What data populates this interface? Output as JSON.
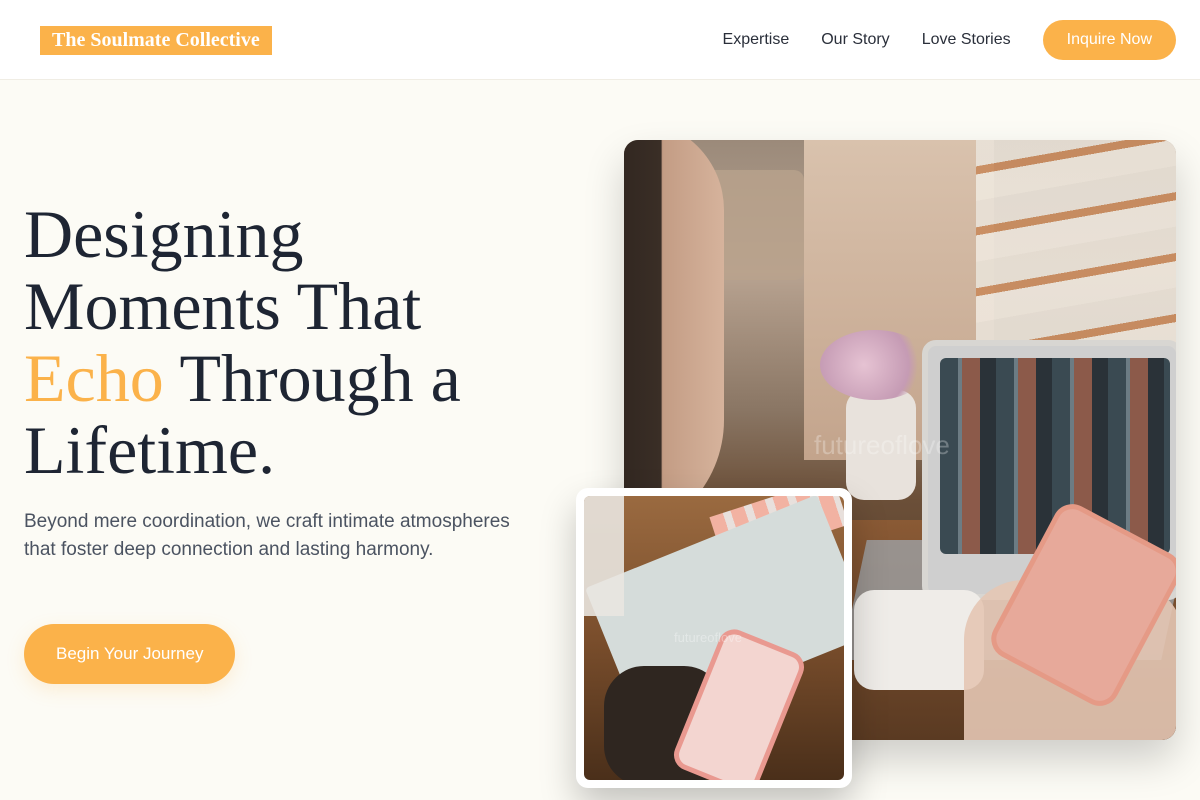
{
  "header": {
    "brand": "The Soulmate Collective",
    "nav": [
      {
        "label": "Expertise"
      },
      {
        "label": "Our Story"
      },
      {
        "label": "Love Stories"
      }
    ],
    "cta_label": "Inquire Now"
  },
  "hero": {
    "headline_line1": "Designing",
    "headline_line2": "Moments That",
    "headline_accent": "Echo",
    "headline_line3_rest": " Through a",
    "headline_line4": "Lifetime.",
    "subtext": "Beyond mere coordination, we craft intimate atmospheres that foster deep connection and lasting harmony.",
    "button_label": "Begin Your Journey"
  },
  "images": {
    "main_watermark": "futureoflove",
    "inset_watermark": "futureoflove"
  },
  "colors": {
    "accent": "#fbb24a",
    "background": "#fcfbf5",
    "heading": "#1e2533",
    "body_text": "#4b5361"
  }
}
